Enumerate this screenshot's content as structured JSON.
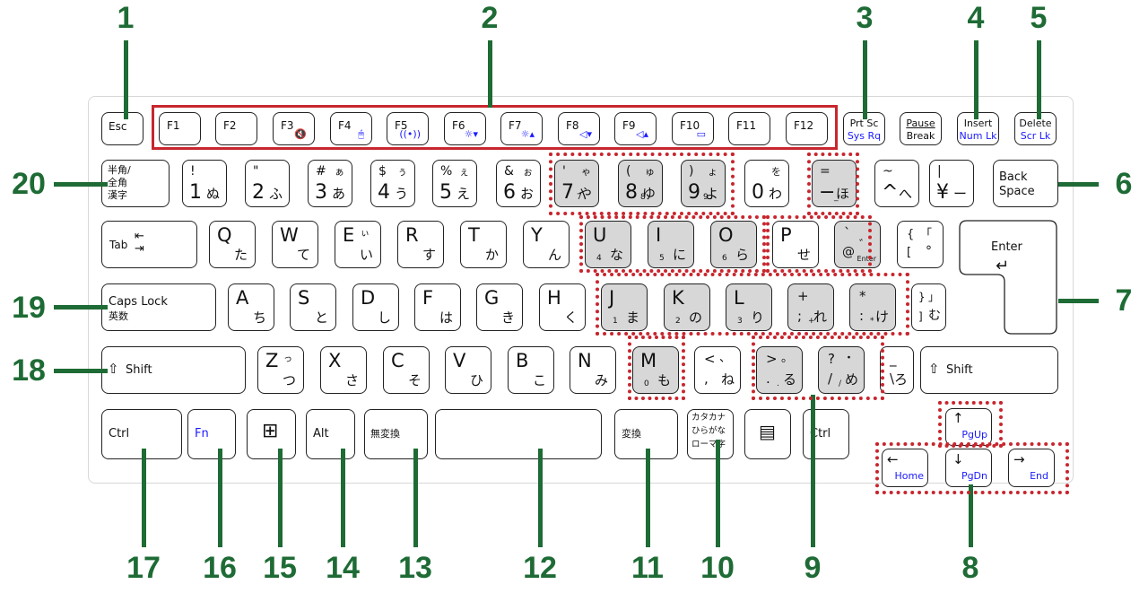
{
  "callouts": [
    {
      "n": "1",
      "label_key": "Esc"
    },
    {
      "n": "2",
      "label_key": "F1-F12 function keys"
    },
    {
      "n": "3",
      "label_key": "Prt Sc / Sys Rq"
    },
    {
      "n": "4",
      "label_key": "Insert / Num Lk"
    },
    {
      "n": "5",
      "label_key": "Delete / Scr Lk"
    },
    {
      "n": "6",
      "label_key": "Back Space"
    },
    {
      "n": "7",
      "label_key": "Enter"
    },
    {
      "n": "8",
      "label_key": "Arrow keys"
    },
    {
      "n": "9",
      "label_key": "Numeric keypad keys"
    },
    {
      "n": "10",
      "label_key": "カタカナ ひらがな ローマ字"
    },
    {
      "n": "11",
      "label_key": "変換"
    },
    {
      "n": "12",
      "label_key": "Space"
    },
    {
      "n": "13",
      "label_key": "無変換"
    },
    {
      "n": "14",
      "label_key": "Alt"
    },
    {
      "n": "15",
      "label_key": "Windows"
    },
    {
      "n": "16",
      "label_key": "Fn"
    },
    {
      "n": "17",
      "label_key": "Ctrl"
    },
    {
      "n": "18",
      "label_key": "Shift"
    },
    {
      "n": "19",
      "label_key": "Caps Lock 英数"
    },
    {
      "n": "20",
      "label_key": "半角/全角 漢字"
    }
  ],
  "row_f": {
    "esc": "Esc",
    "fkeys": [
      {
        "label": "F1",
        "icon": "",
        "icon_name": ""
      },
      {
        "label": "F2",
        "icon": "",
        "icon_name": ""
      },
      {
        "label": "F3",
        "icon": "🔇",
        "icon_name": "mute-icon"
      },
      {
        "label": "F4",
        "icon": "🖱",
        "icon_name": "touchpad-icon"
      },
      {
        "label": "F5",
        "icon": "((•))",
        "icon_name": "wireless-icon"
      },
      {
        "label": "F6",
        "icon": "☼▾",
        "icon_name": "brightness-down-icon"
      },
      {
        "label": "F7",
        "icon": "☼▴",
        "icon_name": "brightness-up-icon"
      },
      {
        "label": "F8",
        "icon": "◁▾",
        "icon_name": "volume-down-icon"
      },
      {
        "label": "F9",
        "icon": "◁▴",
        "icon_name": "volume-up-icon"
      },
      {
        "label": "F10",
        "icon": "▭",
        "icon_name": "display-icon"
      },
      {
        "label": "F11",
        "icon": "",
        "icon_name": ""
      },
      {
        "label": "F12",
        "icon": "",
        "icon_name": ""
      }
    ],
    "prtsc": {
      "top": "Prt Sc",
      "bottom": "Sys Rq"
    },
    "pause": {
      "top": "Pause",
      "bottom": "Break"
    },
    "insert": {
      "top": "Insert",
      "bottom": "Num Lk"
    },
    "delete": {
      "top": "Delete",
      "bottom": "Scr Lk"
    }
  },
  "row_num": {
    "hankaku": [
      "半角/",
      "全角",
      "漢字"
    ],
    "keys": [
      {
        "tl": "!",
        "tr": "",
        "bl": "1",
        "br": "ぬ",
        "sub": ""
      },
      {
        "tl": "\"",
        "tr": "",
        "bl": "2",
        "br": "ふ",
        "sub": ""
      },
      {
        "tl": "#",
        "tr": "ぁ",
        "bl": "3",
        "br": "あ",
        "sub": ""
      },
      {
        "tl": "$",
        "tr": "ぅ",
        "bl": "4",
        "br": "う",
        "sub": ""
      },
      {
        "tl": "%",
        "tr": "ぇ",
        "bl": "5",
        "br": "え",
        "sub": ""
      },
      {
        "tl": "&",
        "tr": "ぉ",
        "bl": "6",
        "br": "お",
        "sub": ""
      },
      {
        "tl": "'",
        "tr": "ゃ",
        "bl": "7",
        "br": "や",
        "sub": "7"
      },
      {
        "tl": "(",
        "tr": "ゅ",
        "bl": "8",
        "br": "ゆ",
        "sub": "8"
      },
      {
        "tl": ")",
        "tr": "ょ",
        "bl": "9",
        "br": "よ",
        "sub": "9"
      },
      {
        "tl": "",
        "tr": "を",
        "bl": "0",
        "br": "わ",
        "sub": ""
      },
      {
        "tl": "=",
        "tr": "",
        "bl": "−",
        "br": "ほ",
        "sub": "_"
      },
      {
        "tl": "~",
        "tr": "",
        "bl": "^",
        "br": "へ",
        "sub": ""
      },
      {
        "tl": "|",
        "tr": "",
        "bl": "¥",
        "br": "ー",
        "sub": ""
      }
    ],
    "backspace": [
      "Back",
      "Space"
    ]
  },
  "row_q": {
    "tab": "Tab",
    "keys": [
      {
        "l": "Q",
        "tr": "",
        "k": "た",
        "sub": ""
      },
      {
        "l": "W",
        "tr": "",
        "k": "て",
        "sub": ""
      },
      {
        "l": "E",
        "tr": "ぃ",
        "k": "い",
        "sub": ""
      },
      {
        "l": "R",
        "tr": "",
        "k": "す",
        "sub": ""
      },
      {
        "l": "T",
        "tr": "",
        "k": "か",
        "sub": ""
      },
      {
        "l": "Y",
        "tr": "",
        "k": "ん",
        "sub": ""
      },
      {
        "l": "U",
        "tr": "",
        "k": "な",
        "sub": "4"
      },
      {
        "l": "I",
        "tr": "",
        "k": "に",
        "sub": "5"
      },
      {
        "l": "O",
        "tr": "",
        "k": "ら",
        "sub": "6"
      },
      {
        "l": "P",
        "tr": "",
        "k": "せ",
        "sub": ""
      }
    ],
    "at": {
      "tl": "`",
      "bl": "@",
      "tr": "゛",
      "sub": "Enter"
    },
    "bracket": {
      "tl": "{",
      "tr": "「",
      "bl": "[",
      "br": "°"
    },
    "enter": "Enter"
  },
  "row_a": {
    "caps": [
      "Caps Lock",
      "英数"
    ],
    "keys": [
      {
        "l": "A",
        "k": "ち",
        "sub": ""
      },
      {
        "l": "S",
        "k": "と",
        "sub": ""
      },
      {
        "l": "D",
        "k": "し",
        "sub": ""
      },
      {
        "l": "F",
        "k": "は",
        "sub": ""
      },
      {
        "l": "G",
        "k": "き",
        "sub": ""
      },
      {
        "l": "H",
        "k": "く",
        "sub": ""
      },
      {
        "l": "J",
        "k": "ま",
        "sub": "1"
      },
      {
        "l": "K",
        "k": "の",
        "sub": "2"
      },
      {
        "l": "L",
        "k": "り",
        "sub": "3"
      }
    ],
    "semi": {
      "tl": "+",
      "bl": ";",
      "sub": "+",
      "br": "れ"
    },
    "colon": {
      "tl": "*",
      "bl": ":",
      "sub": "*",
      "br": "け"
    },
    "rbracket": {
      "tl": "}",
      "tr": "」",
      "bl": "]",
      "br": "む"
    }
  },
  "row_z": {
    "shift": "Shift",
    "keys": [
      {
        "l": "Z",
        "tr": "っ",
        "k": "つ",
        "sub": ""
      },
      {
        "l": "X",
        "tr": "",
        "k": "さ",
        "sub": ""
      },
      {
        "l": "C",
        "tr": "",
        "k": "そ",
        "sub": ""
      },
      {
        "l": "V",
        "tr": "",
        "k": "ひ",
        "sub": ""
      },
      {
        "l": "B",
        "tr": "",
        "k": "こ",
        "sub": ""
      },
      {
        "l": "N",
        "tr": "",
        "k": "み",
        "sub": ""
      },
      {
        "l": "M",
        "tr": "",
        "k": "も",
        "sub": "0"
      }
    ],
    "comma": {
      "tl": "<",
      "tr": "、",
      "bl": ",",
      "br": "ね"
    },
    "period": {
      "tl": ">",
      "tr": "。",
      "bl": ".",
      "sub": ".",
      "br": "る"
    },
    "slash": {
      "tl": "?",
      "tr": "・",
      "bl": "/",
      "sub": "/",
      "br": "め"
    },
    "backslash": {
      "tl": "_",
      "bl": "\\",
      "br": "ろ"
    },
    "rshift": "Shift"
  },
  "row_bottom": {
    "ctrl": "Ctrl",
    "fn": "Fn",
    "alt": "Alt",
    "muhenkan": "無変換",
    "henkan": "変換",
    "kana": [
      "カタカナ",
      "ひらがな",
      "ローマ字"
    ],
    "rctrl": "Ctrl",
    "pgup": "PgUp",
    "pgdn": "PgDn",
    "home": "Home",
    "end": "End"
  },
  "colors": {
    "callout": "#1e6b35",
    "highlight": "#c8262e",
    "fn_blue": "#1a1aff",
    "numpad_key": "#d7d7d7"
  }
}
